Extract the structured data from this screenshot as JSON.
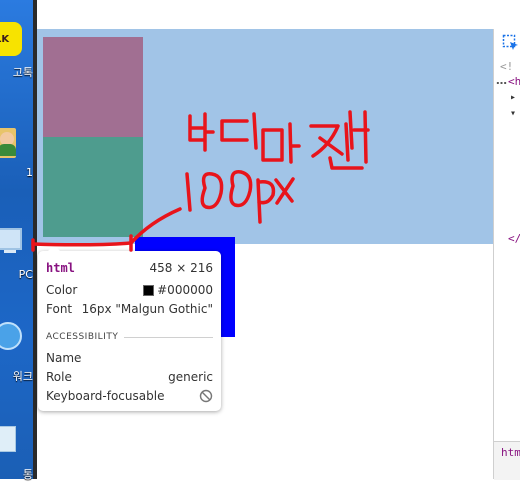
{
  "desktop": {
    "items": [
      {
        "label": "고톡"
      },
      {
        "label": "1"
      },
      {
        "label": "PC"
      },
      {
        "label": "워크"
      },
      {
        "label": "통"
      }
    ]
  },
  "tooltip": {
    "tag": "html",
    "dimensions": "458 × 216",
    "color_label": "Color",
    "color_value": "#000000",
    "font_label": "Font",
    "font_value": "16px \"Malgun Gothic\"",
    "section_title": "ACCESSIBILITY",
    "name_label": "Name",
    "role_label": "Role",
    "role_value": "generic",
    "focusable_label": "Keyboard-focusable"
  },
  "devtools": {
    "lines": [
      "<!",
      "<h",
      "▸",
      "▾",
      "</"
    ],
    "bottom_tab": "htm"
  },
  "colors": {
    "html_background": "#a1c4e7",
    "box_pink": "#a16f92",
    "box_teal": "#4e9c8e",
    "blue_box": "#0000ff",
    "annotation": "#e8141b"
  },
  "annotation": {
    "handwritten_text": "바디 마진 100px"
  }
}
